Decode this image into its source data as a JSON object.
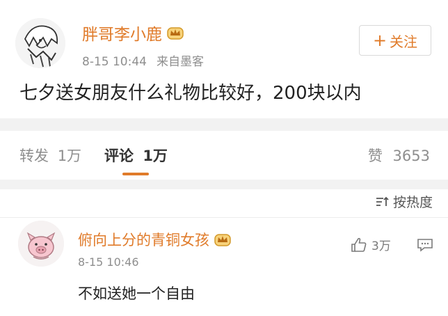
{
  "post": {
    "author": "胖哥李小鹿",
    "time": "8-15 10:44",
    "source": "来自墨客",
    "follow_plus": "+",
    "follow_label": "关注",
    "text": "七夕送女朋友什么礼物比较好，200块以内",
    "avatar_icon": "anime-character-avatar-icon",
    "badge_icon": "crown-icon"
  },
  "tabs": {
    "repost_label": "转发",
    "repost_count": "1万",
    "comment_label": "评论",
    "comment_count": "1万",
    "like_label": "赞",
    "like_count": "3653"
  },
  "sort": {
    "label": "按热度",
    "icon": "sort-icon"
  },
  "comment": {
    "author": "俯向上分的青铜女孩",
    "time": "8-15 10:46",
    "text": "不如送她一个自由",
    "like_count": "3万",
    "avatar_icon": "pig-avatar-icon",
    "badge_icon": "crown-icon"
  },
  "colors": {
    "accent": "#e07b2a",
    "muted": "#8e8e8e",
    "separator": "#f2f2f2"
  }
}
